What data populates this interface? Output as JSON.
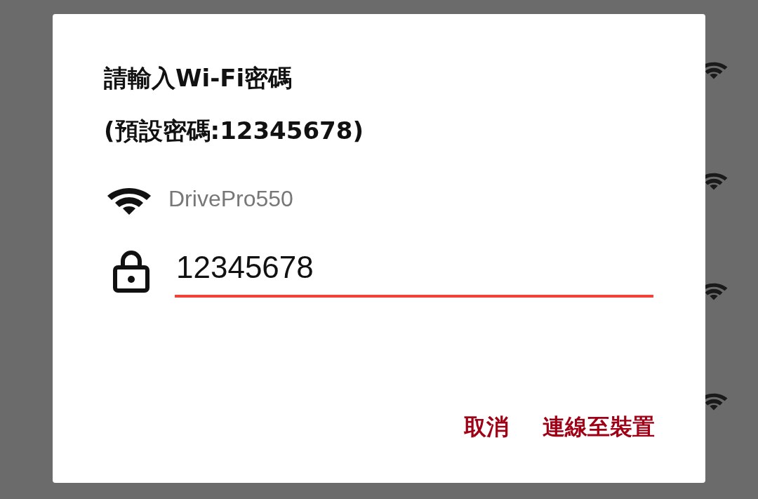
{
  "dialog": {
    "title_lines": [
      "請輸入Wi-Fi密碼",
      "(預設密碼:12345678)"
    ],
    "network": {
      "name": "DrivePro550"
    },
    "password": {
      "value": "12345678",
      "focused": true
    },
    "buttons": [
      {
        "label": "取消"
      },
      {
        "label": "連線至裝置"
      }
    ]
  }
}
